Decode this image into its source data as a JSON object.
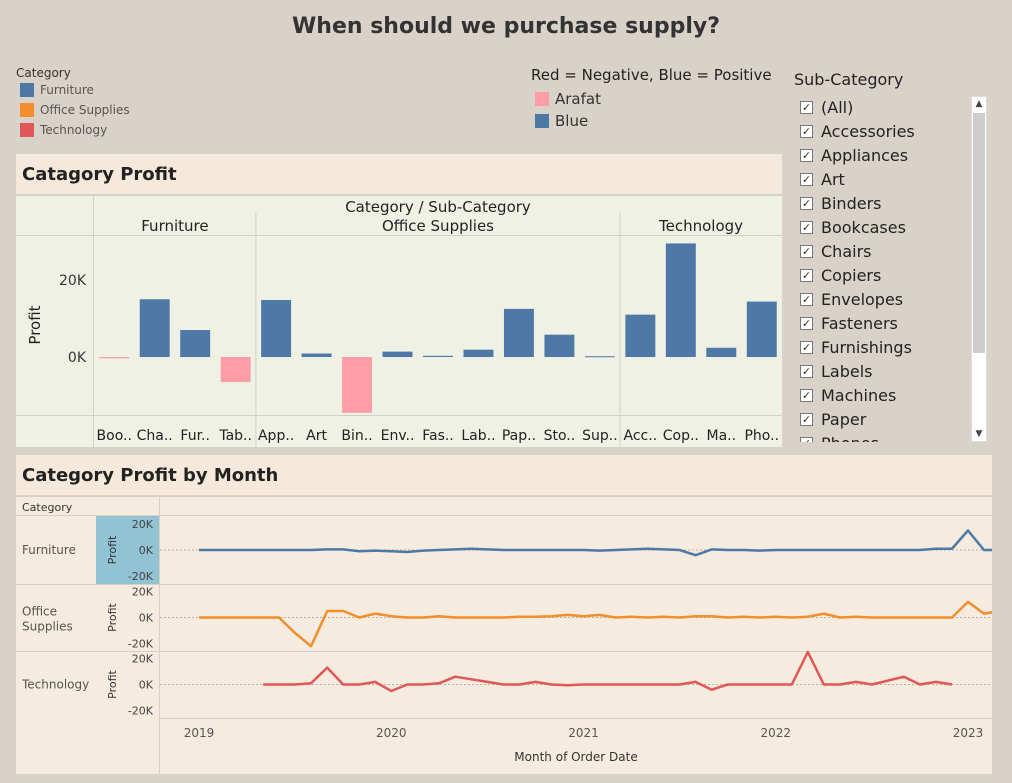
{
  "title": "When should we purchase supply?",
  "category_legend": {
    "title": "Category",
    "items": [
      {
        "label": "Furniture",
        "color": "#4e79a7"
      },
      {
        "label": "Office Supplies",
        "color": "#f28e2b"
      },
      {
        "label": "Technology",
        "color": "#e15759"
      }
    ]
  },
  "color_legend": {
    "title": "Red = Negative, Blue = Positive",
    "items": [
      {
        "label": "Arafat",
        "color": "#ff9da7"
      },
      {
        "label": "Blue",
        "color": "#4e79a7"
      }
    ]
  },
  "subcategory_filter": {
    "title": "Sub-Category",
    "items": [
      "(All)",
      "Accessories",
      "Appliances",
      "Art",
      "Binders",
      "Bookcases",
      "Chairs",
      "Copiers",
      "Envelopes",
      "Fasteners",
      "Furnishings",
      "Labels",
      "Machines",
      "Paper",
      "Phones"
    ],
    "scroll_up_icon": "chevron-up-icon",
    "scroll_down_icon": "chevron-down-icon"
  },
  "chart_data": [
    {
      "type": "bar",
      "title": "Catagory Profit",
      "header": "Category / Sub-Category",
      "groups": [
        "Furniture",
        "Office Supplies",
        "Technology"
      ],
      "ylabel": "Profit",
      "y_ticks": [
        "0K",
        "20K"
      ],
      "ylim": [
        -18000,
        34000
      ],
      "categories": [
        {
          "group": "Furniture",
          "label": "Boo..",
          "value": -350
        },
        {
          "group": "Furniture",
          "label": "Cha..",
          "value": 15000
        },
        {
          "group": "Furniture",
          "label": "Fur..",
          "value": 7000
        },
        {
          "group": "Furniture",
          "label": "Tab..",
          "value": -6500
        },
        {
          "group": "Office Supplies",
          "label": "App..",
          "value": 14800
        },
        {
          "group": "Office Supplies",
          "label": "Art",
          "value": 900
        },
        {
          "group": "Office Supplies",
          "label": "Bin..",
          "value": -14500
        },
        {
          "group": "Office Supplies",
          "label": "Env..",
          "value": 1400
        },
        {
          "group": "Office Supplies",
          "label": "Fas..",
          "value": 300
        },
        {
          "group": "Office Supplies",
          "label": "Lab..",
          "value": 1900
        },
        {
          "group": "Office Supplies",
          "label": "Pap..",
          "value": 12500
        },
        {
          "group": "Office Supplies",
          "label": "Sto..",
          "value": 5800
        },
        {
          "group": "Office Supplies",
          "label": "Sup..",
          "value": 200
        },
        {
          "group": "Technology",
          "label": "Acc..",
          "value": 11000
        },
        {
          "group": "Technology",
          "label": "Cop..",
          "value": 29500
        },
        {
          "group": "Technology",
          "label": "Ma..",
          "value": 2400
        },
        {
          "group": "Technology",
          "label": "Pho..",
          "value": 14400
        }
      ],
      "positive_color": "#4e79a7",
      "negative_color": "#ff9da7"
    },
    {
      "type": "line",
      "title": "Category Profit by Month",
      "row_header": "Category",
      "xlabel": "Month of Order Date",
      "ylabel": "Profit",
      "x_ticks": [
        "2019",
        "2020",
        "2021",
        "2022",
        "2023"
      ],
      "y_ticks": [
        "20K",
        "0K",
        "-20K"
      ],
      "ylim": [
        -25000,
        25000
      ],
      "x_start": "2019-01",
      "series": [
        {
          "name": "Furniture",
          "color": "#4e79a7",
          "values": [
            0,
            0,
            0,
            0,
            0,
            0,
            0,
            0,
            500,
            500,
            -1000,
            -500,
            -1000,
            -1500,
            -500,
            0,
            500,
            1000,
            500,
            0,
            0,
            0,
            0,
            0,
            0,
            -500,
            0,
            500,
            1000,
            500,
            0,
            -4000,
            500,
            0,
            0,
            -500,
            0,
            0,
            0,
            0,
            0,
            0,
            0,
            0,
            0,
            0,
            1000,
            1000,
            15000,
            0,
            0,
            -1000
          ]
        },
        {
          "name": "Office Supplies",
          "color": "#f28e2b",
          "values": [
            0,
            0,
            0,
            0,
            0,
            0,
            -12000,
            -22000,
            5000,
            5000,
            0,
            3000,
            1000,
            0,
            0,
            1000,
            0,
            0,
            0,
            0,
            500,
            500,
            1000,
            2000,
            1000,
            2000,
            0,
            500,
            0,
            500,
            0,
            1000,
            1000,
            0,
            500,
            0,
            500,
            0,
            500,
            3000,
            0,
            500,
            0,
            0,
            0,
            0,
            0,
            0,
            12000,
            3000,
            5000,
            0,
            0
          ]
        },
        {
          "name": "Technology",
          "color": "#e15759",
          "values": [
            null,
            null,
            null,
            null,
            0,
            0,
            0,
            1000,
            13000,
            0,
            0,
            2000,
            -5000,
            0,
            0,
            1000,
            6000,
            4000,
            2000,
            0,
            0,
            2000,
            0,
            -500,
            0,
            0,
            0,
            0,
            0,
            0,
            0,
            2000,
            -4000,
            0,
            0,
            0,
            0,
            0,
            25000,
            0,
            0,
            2000,
            0,
            3000,
            6000,
            0,
            2000,
            0
          ]
        }
      ]
    }
  ]
}
